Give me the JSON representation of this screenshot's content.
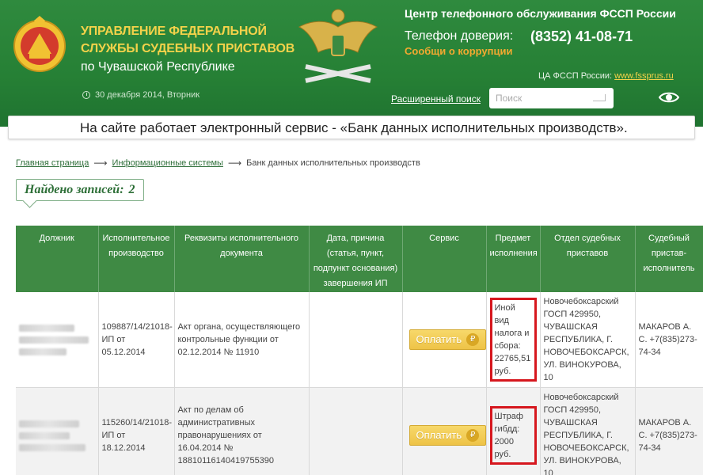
{
  "header": {
    "org_line1": "УПРАВЛЕНИЕ ФЕДЕРАЛЬНОЙ",
    "org_line2": "СЛУЖБЫ СУДЕБНЫХ ПРИСТАВОВ",
    "org_line3": "по Чувашской Республике",
    "date": "30 декабря 2014, Вторник",
    "callcenter": "Центр телефонного обслуживания ФССП России",
    "trust_label": "Телефон доверия:",
    "trust_phone": "(8352) 41-08-71",
    "corruption": "Сообщи о коррупции",
    "ca_label": "ЦА ФССП России: ",
    "ca_link": "www.fssprus.ru",
    "advanced_search": "Расширенный поиск",
    "search_placeholder": "Поиск"
  },
  "banner": {
    "text": "На сайте работает электронный сервис - «Банк данных исполнительных производств»."
  },
  "breadcrumb": {
    "items": [
      "Главная страница",
      "Информационные системы",
      "Банк данных исполнительных производств"
    ]
  },
  "found": {
    "label": "Найдено записей:",
    "count": "2"
  },
  "table": {
    "headers": [
      "Должник",
      "Исполнительное производство",
      "Реквизиты исполнительного документа",
      "Дата, причина (статья, пункт, подпункт основания) завершения ИП",
      "Сервис",
      "Предмет исполнения",
      "Отдел судебных приставов",
      "Судебный пристав-исполнитель"
    ],
    "rows": [
      {
        "proceeding": "109887/14/21018-ИП от 05.12.2014",
        "document": "Акт органа, осуществляющего контрольные функции от 02.12.2014 № 11910",
        "end": "",
        "pay_label": "Оплатить",
        "subject": "Иной вид налога и сбора: 22765,51 руб.",
        "department": "Новочебоксарский ГОСП 429950, ЧУВАШСКАЯ РЕСПУБЛИКА, Г. НОВОЧЕБОКСАРСК, УЛ. ВИНОКУРОВА, 10",
        "bailiff": "МАКАРОВ А. С. +7(835)273-74-34"
      },
      {
        "proceeding": "115260/14/21018-ИП от 18.12.2014",
        "document": "Акт по делам об административных правонарушениях от 16.04.2014 № 18810116140419755390",
        "end": "",
        "pay_label": "Оплатить",
        "subject": "Штраф гибдд: 2000 руб.",
        "department": "Новочебоксарский ГОСП 429950, ЧУВАШСКАЯ РЕСПУБЛИКА, Г. НОВОЧЕБОКСАРСК, УЛ. ВИНОКУРОВА, 10",
        "bailiff": "МАКАРОВ А. С. +7(835)273-74-34"
      }
    ]
  },
  "colors": {
    "header_green": "#2f8a3e",
    "table_header_green": "#3f8a44",
    "gold_text": "#f3d24a",
    "pay_button": "#eec347",
    "highlight_red": "#d6171e"
  }
}
